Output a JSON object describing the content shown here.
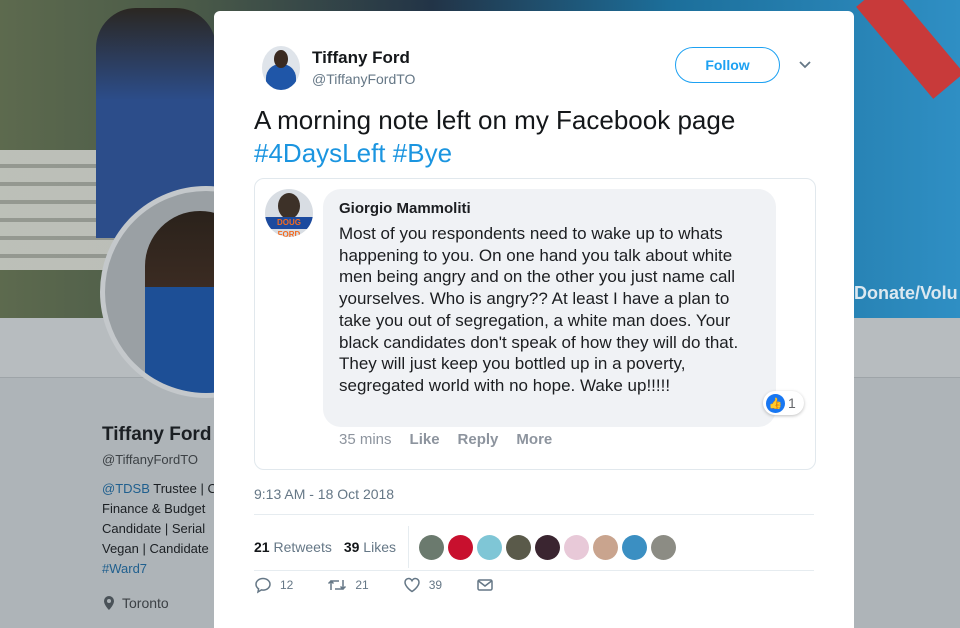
{
  "background": {
    "banner_text": "Donate/Volu",
    "profile_name": "Tiffany Ford",
    "profile_handle": "@TiffanyFordTO",
    "bio_lines": [
      {
        "link": "@TDSB",
        "text": " Trustee | C"
      },
      {
        "link": "",
        "text": "Finance & Budget"
      },
      {
        "link": "",
        "text": "Candidate | Serial"
      },
      {
        "link": "",
        "text": "Vegan | Candidate"
      },
      {
        "link": "#Ward7",
        "text": ""
      }
    ],
    "location": "Toronto"
  },
  "tweet": {
    "author_name": "Tiffany Ford",
    "author_handle": "@TiffanyFordTO",
    "follow_label": "Follow",
    "text": "A morning note left on my Facebook page",
    "hashtags": [
      "#4DaysLeft",
      "#Bye"
    ],
    "embedded_comment": {
      "author": "Giorgio Mammoliti",
      "avatar_badge": "DOUG FORD",
      "text": "Most of you respondents need to wake up to whats happening to you. On one hand you talk about white men being angry and on the other you just name call yourselves. Who is angry?? At least I have a plan to take you out of segregation, a white man does. Your black candidates don't speak of how they will do that. They will just keep you bottled up in a poverty, segregated world with no hope. Wake up!!!!!",
      "like_count": "1",
      "time": "35 mins",
      "actions": [
        "Like",
        "Reply",
        "More"
      ]
    },
    "timestamp": "9:13 AM - 18 Oct 2018",
    "retweets_count": "21",
    "retweets_label": "Retweets",
    "likes_count": "39",
    "likes_label": "Likes",
    "liker_avatar_colors": [
      "#6b7a6e",
      "#c8102e",
      "#7fc6d6",
      "#5a5a4a",
      "#3a2530",
      "#e8c9d8",
      "#c9a48e",
      "#3b8fc2",
      "#8c8c84"
    ],
    "action_counts": {
      "reply": "12",
      "retweet": "21",
      "like": "39"
    }
  },
  "colors": {
    "accent": "#1da1f2",
    "hashtag": "#1b95e0",
    "fb_blue": "#1877f2"
  }
}
